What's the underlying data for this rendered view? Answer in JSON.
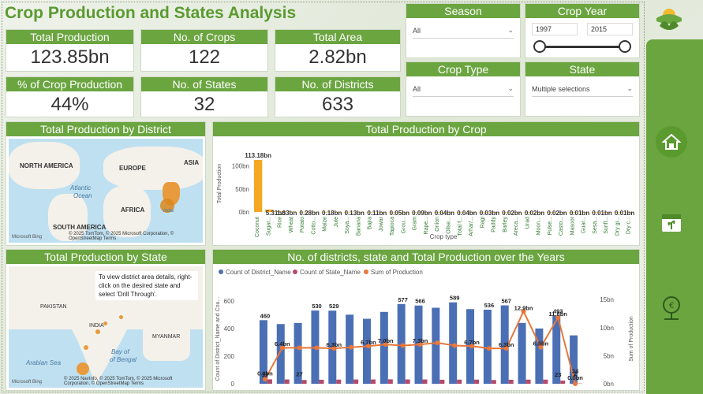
{
  "title": "Crop Production and States Analysis",
  "kpis": {
    "total_production": {
      "label": "Total Production",
      "value": "123.85bn"
    },
    "no_of_crops": {
      "label": "No. of Crops",
      "value": "122"
    },
    "total_area": {
      "label": "Total Area",
      "value": "2.82bn"
    },
    "pct_crop_production": {
      "label": "% of Crop Production",
      "value": "44%"
    },
    "no_of_states": {
      "label": "No. of States",
      "value": "32"
    },
    "no_of_districts": {
      "label": "No. of Districts",
      "value": "633"
    }
  },
  "slicers": {
    "season": {
      "label": "Season",
      "value": "All"
    },
    "crop_year": {
      "label": "Crop Year",
      "from": "1997",
      "to": "2015"
    },
    "crop_type": {
      "label": "Crop Type",
      "value": "All"
    },
    "state": {
      "label": "State",
      "value": "Multiple selections"
    }
  },
  "district_map": {
    "title": "Total Production by District",
    "labels": {
      "north_america": "NORTH AMERICA",
      "europe": "EUROPE",
      "asia": "ASIA",
      "atlantic": "Atlantic",
      "ocean": "Ocean",
      "africa": "AFRICA",
      "south_america": "SOUTH AMERICA",
      "india": "India"
    },
    "copyright": "© 2025 TomTom, © 2025 Microsoft Corporation, © OpenStreetMap Terms",
    "logo": "Microsoft Bing"
  },
  "state_map": {
    "title": "Total Production by State",
    "tooltip": "To view district area details, right-click on the desired state and select 'Drill Through'.",
    "labels": {
      "pakistan": "PAKISTAN",
      "india": "INDIA",
      "myanmar": "MYANMAR",
      "arabian_sea": "Arabian Sea",
      "bay": "Bay of",
      "bengal": "of Bengal"
    },
    "copyright": "© 2025 NavInfo, © 2025 TomTom, © 2025 Microsoft Corporation, © OpenStreetMap Terms",
    "logo": "Microsoft Bing"
  },
  "crop_chart": {
    "title": "Total Production by Crop",
    "xlabel": "Crop type",
    "ylabel": "Total Production"
  },
  "years_chart": {
    "title": "No. of districts, state and Total Production over the Years",
    "xlabel": "Crop_Year",
    "ylabel_left": "Count of District_Name and Cou...",
    "ylabel_right": "Sum of Production",
    "legend": [
      "Count of District_Name",
      "Count of State_Name",
      "Sum of Production"
    ]
  },
  "colors": {
    "accent": "#6ba540",
    "bar_blue": "#4a6fb5",
    "bar_pink": "#b54a6b",
    "line_orange": "#e8773a",
    "crop_bar": "#f5a623"
  },
  "nav_icons": [
    "home-icon",
    "calendar-plant-icon",
    "money-location-icon"
  ],
  "chart_data": [
    {
      "type": "bar",
      "title": "Total Production by Crop",
      "xlabel": "Crop type",
      "ylabel": "Total Production",
      "categories": [
        "Coconut",
        "Sugar...",
        "Rice",
        "Wheat",
        "Potato",
        "Cotto...",
        "Maize",
        "Jute",
        "Soya...",
        "Banana",
        "Bajra",
        "Jowar",
        "Tapioca",
        "Grou...",
        "Gram",
        "Rape...",
        "Onion",
        "Oilse...",
        "Total f...",
        "Arhar/...",
        "Ragi",
        "Paddy",
        "Barley",
        "Areca...",
        "Urad",
        "Moon...",
        "Pulse...",
        "Casto...",
        "Masoor",
        "Guar...",
        "Sesa...",
        "Sunfl...",
        "Dry gi...",
        "Dry c..."
      ],
      "values": [
        113.18,
        5.31,
        1.33,
        1.0,
        0.28,
        0.28,
        0.18,
        0.18,
        0.13,
        0.13,
        0.11,
        0.11,
        0.05,
        0.05,
        0.09,
        0.09,
        0.04,
        0.04,
        0.04,
        0.04,
        0.03,
        0.03,
        0.02,
        0.02,
        0.02,
        0.02,
        0.02,
        0.02,
        0.01,
        0.01,
        0.01,
        0.01,
        0.01,
        0.01
      ],
      "data_labels": [
        "113.18bn",
        "5.31bn",
        "1.33bn",
        "0.28bn",
        "0.18bn",
        "0.13bn",
        "0.11bn",
        "0.05bn",
        "0.09bn",
        "0.04bn",
        "0.04bn",
        "0.03bn",
        "0.02bn",
        "0.02bn",
        "0.02bn",
        "0.01bn",
        "0.01bn",
        "0.01bn"
      ],
      "yticks": [
        "100bn",
        "50bn",
        "0bn"
      ],
      "ylim": [
        0,
        120
      ]
    },
    {
      "type": "bar",
      "title": "No. of districts, state and Total Production over the Years",
      "xlabel": "Crop_Year",
      "x": [
        "1997",
        "1998",
        "1999",
        "2000",
        "2001",
        "2002",
        "2003",
        "2004",
        "2005",
        "2006",
        "2007",
        "2008",
        "2009",
        "2010",
        "2011",
        "2012",
        "2013",
        "2014",
        "2015"
      ],
      "series": [
        {
          "name": "Count of District_Name",
          "values": [
            460,
            432,
            440,
            530,
            529,
            500,
            470,
            520,
            577,
            566,
            550,
            589,
            540,
            536,
            567,
            440,
            400,
            493,
            350
          ]
        },
        {
          "name": "Count of State_Name",
          "values": [
            32,
            31,
            27,
            29,
            30,
            31,
            31,
            32,
            31,
            31,
            29,
            30,
            30,
            27,
            29,
            30,
            30,
            23,
            2
          ]
        },
        {
          "name": "Sum of Production",
          "values": [
            0.8,
            6.4,
            6.4,
            6.4,
            6.3,
            6.5,
            6.7,
            7.0,
            6.8,
            7.0,
            7.3,
            6.8,
            6.7,
            6.3,
            6.3,
            12.9,
            6.5,
            11.8,
            0.0
          ]
        }
      ],
      "labels": [
        "460",
        "32",
        "6.4bn",
        "530",
        "27",
        "529",
        "6.3bn",
        "6.7bn",
        "7.0bn",
        "31",
        "32",
        "577",
        "566",
        "7.3bn",
        "31",
        "589",
        "6.7bn",
        "536",
        "27",
        "6.3bn",
        "567",
        "29",
        "12.9bn",
        "6.5bn",
        "493",
        "11.8bn",
        "23",
        "34",
        "2",
        "0.8bn",
        "0.0bn"
      ],
      "yticks_left": [
        "600",
        "400",
        "200",
        "0"
      ],
      "yticks_right": [
        "15bn",
        "10bn",
        "5bn",
        "0bn"
      ],
      "xticks": [
        "2000",
        "2005",
        "2010",
        "2015"
      ],
      "ylim": [
        0,
        650
      ]
    }
  ]
}
